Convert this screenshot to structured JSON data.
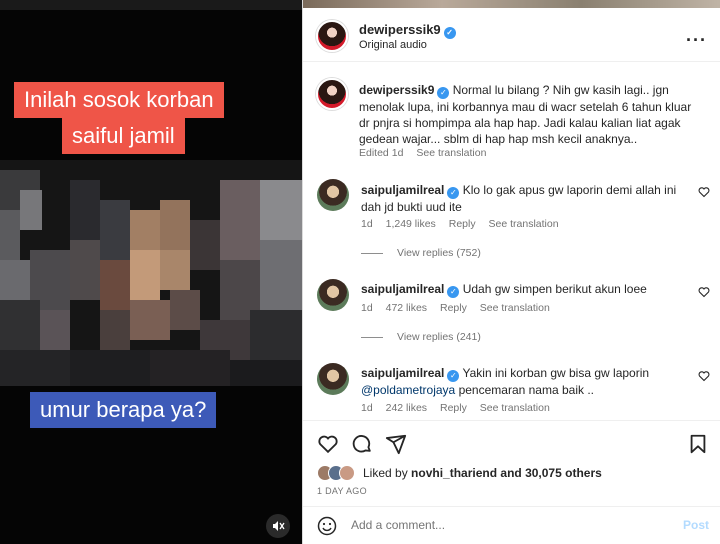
{
  "video": {
    "caption_line1": "Inilah sosok korban",
    "caption_line2": "saiful jamil",
    "caption_question": "umur berapa ya?",
    "mute_icon": "speaker-muted-icon"
  },
  "header": {
    "username": "dewiperssik9",
    "subtitle": "Original audio",
    "more_icon": "more-dots-icon"
  },
  "post": {
    "username": "dewiperssik9",
    "text": "Normal lu bilang ? Nih gw kasih lagi.. jgn menolak lupa, ini korbannya mau di wacr setelah 6 tahun kluar dr pnjra si hompimpa ala hap hap. Jadi kalau kalian liat agak gedean wajar... sblm di hap hap msh kecil anaknya..",
    "edited": "Edited",
    "time": "1d",
    "see_translation": "See translation"
  },
  "comments": [
    {
      "username": "saipuljamilreal",
      "text": "Klo lo gak apus gw laporin demi allah ini dah jd bukti uud ite",
      "time": "1d",
      "likes": "1,249 likes",
      "reply": "Reply",
      "see_translation": "See translation",
      "view_replies": "View replies (752)"
    },
    {
      "username": "saipuljamilreal",
      "text": "Udah gw simpen berikut akun loee",
      "time": "1d",
      "likes": "472 likes",
      "reply": "Reply",
      "see_translation": "See translation",
      "view_replies": "View replies (241)"
    },
    {
      "username": "saipuljamilreal",
      "mention": "@poldametrojaya",
      "text_before": "Yakin ini korban gw bisa gw laporin",
      "text_after": "pencemaran nama baik ..",
      "time": "1d",
      "likes": "242 likes",
      "reply": "Reply",
      "see_translation": "See translation"
    }
  ],
  "actions": {
    "icons": [
      "heart-icon",
      "comment-icon",
      "share-icon",
      "bookmark-icon"
    ]
  },
  "likes_line": {
    "prefix": "Liked by",
    "user": "novhi_thariend",
    "suffix": "and 30,075 others"
  },
  "time_ago": "1 DAY AGO",
  "add_comment": {
    "placeholder": "Add a comment...",
    "post_label": "Post"
  },
  "colors": {
    "caption_red": "#ef5548",
    "caption_blue": "#3d5ab8",
    "verified_blue": "#3897f0",
    "link": "#00376b"
  }
}
